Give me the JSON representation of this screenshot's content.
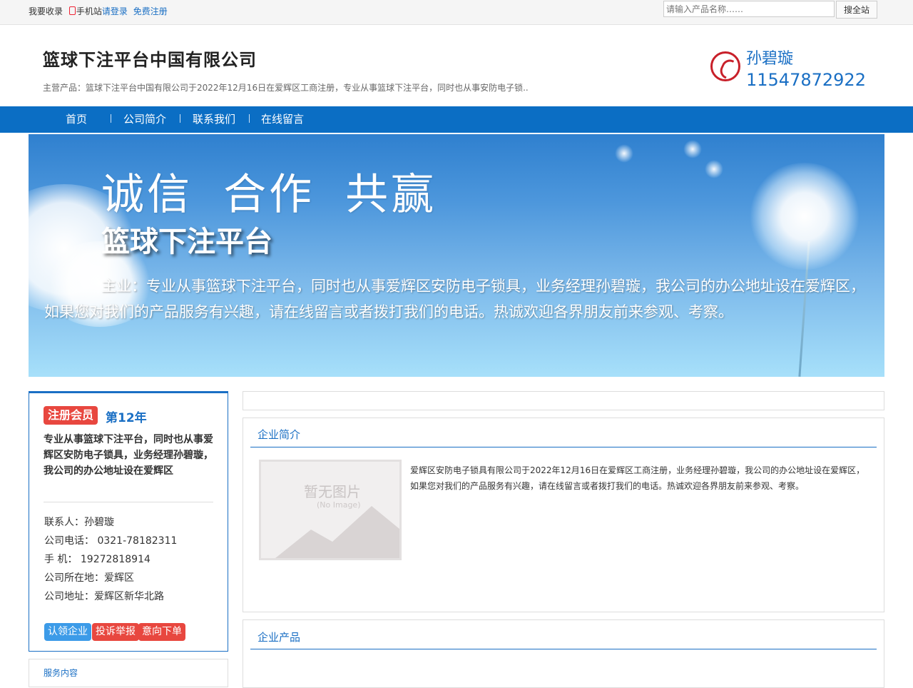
{
  "topbar": {
    "want_listing": "我要收录",
    "mobile_site": "手机站",
    "login": "请登录",
    "register": "免费注册",
    "search_placeholder": "请输入产品名称……",
    "search_button": "搜全站"
  },
  "header": {
    "company_name": "篮球下注平台中国有限公司",
    "main_products": "主营产品：篮球下注平台中国有限公司于2022年12月16日在爱辉区工商注册，专业从事篮球下注平台，同时也从事安防电子锁..",
    "contact_name": "孙碧璇",
    "contact_phone": "11547872922"
  },
  "nav": {
    "items": [
      "首页",
      "公司简介",
      "联系我们",
      "在线留言"
    ]
  },
  "banner": {
    "slogan": "诚信 合作 共赢",
    "brand": "篮球下注平台",
    "description": "主业：专业从事篮球下注平台，同时也从事爱辉区安防电子锁具，业务经理孙碧璇，我公司的办公地址设在爱辉区，如果您对我们的产品服务有兴趣，请在线留言或者拨打我们的电话。热诚欢迎各界朋友前来参观、考察。"
  },
  "sidebar": {
    "member_badge": "注册会员",
    "member_years": "第12年",
    "intro": "专业从事篮球下注平台，同时也从事爱辉区安防电子锁具，业务经理孙碧璇，我公司的办公地址设在爱辉区",
    "contact_person": "联系人：孙碧璇",
    "company_phone": "公司电话： 0321-78182311",
    "mobile": "手 机： 19272818914",
    "location": "公司所在地：爱辉区",
    "address": "公司地址：爱辉区新华北路",
    "buttons": [
      "认领企业",
      "投诉举报",
      "意向下单"
    ],
    "services_title": "服务内容"
  },
  "main": {
    "profile_title": "企业简介",
    "no_image_text": "暂无图片",
    "no_image_en": "(No Image)",
    "profile_text": "爱辉区安防电子锁具有限公司于2022年12月16日在爱辉区工商注册，业务经理孙碧璇，我公司的办公地址设在爱辉区，如果您对我们的产品服务有兴趣，请在线留言或者拨打我们的电话。热诚欢迎各界朋友前来参观、考察。",
    "products_title": "企业产品"
  },
  "colors": {
    "brand_blue": "#0b6ec4",
    "badge_red": "#e8473f",
    "button_blue": "#3c9be8"
  }
}
